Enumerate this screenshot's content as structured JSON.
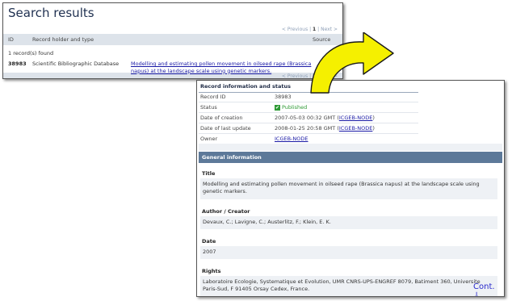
{
  "search": {
    "title": "Search results",
    "pager": {
      "prev": "< Previous",
      "page": "1",
      "next": "Next >"
    },
    "columns": {
      "id": "ID",
      "holder": "Record holder and type",
      "source": "Source"
    },
    "count_text": "1 record(s) found",
    "result": {
      "id": "38983",
      "type": "Scientific Bibliographic Database",
      "title": "Modelling and estimating pollen movement in oilseed rape (Brassica napus) at the landscape scale using genetic markers."
    }
  },
  "record": {
    "section_title": "Record information and status",
    "rows": [
      {
        "label": "Record ID",
        "value": "38983"
      },
      {
        "label": "Status",
        "value": "Published"
      },
      {
        "label": "Date of creation",
        "value": "2007-05-03 00:32 GMT (",
        "link": "ICGEB-NODE",
        "suffix": ")"
      },
      {
        "label": "Date of last update",
        "value": "2008-01-25 20:58 GMT (",
        "link": "ICGEB-NODE",
        "suffix": ")"
      },
      {
        "label": "Owner",
        "link": "ICGEB-NODE"
      }
    ],
    "general_title": "General information",
    "fields": [
      {
        "label": "Title",
        "value": "Modelling and estimating pollen movement in oilseed rape (Brassica napus) at the landscape scale using genetic markers."
      },
      {
        "label": "Author / Creator",
        "value": "Devaux, C.; Lavigne, C.; Austerlitz, F.; Klein, E. K."
      },
      {
        "label": "Date",
        "value": "2007"
      },
      {
        "label": "Rights",
        "value": "Laboratoire Ecologie, Systematique et Evolution, UMR CNRS-UPS-ENGREF 8079, Batiment 360, Universite Paris-Sud, F 91405 Orsay Cedex, France."
      }
    ]
  },
  "cont_label": "Cont.",
  "colors": {
    "arrow_fill": "#f5f000",
    "header_bar": "#5d7999",
    "link": "#1a1aa6",
    "published": "#2e9a35"
  },
  "icons": {
    "status": "check-icon",
    "cont": "arrow-down-icon"
  }
}
